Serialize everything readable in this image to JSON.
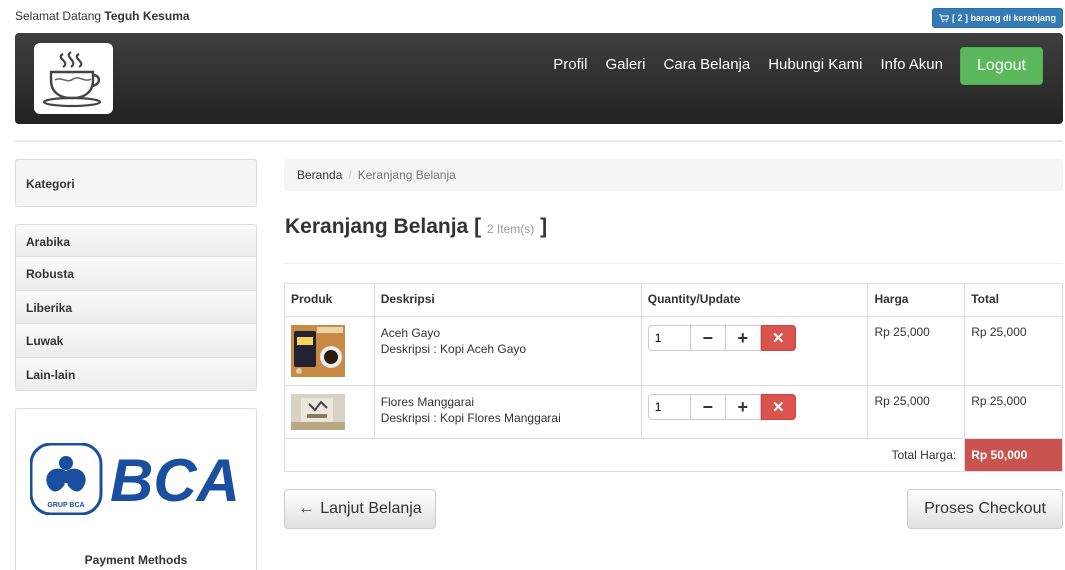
{
  "header": {
    "welcome_prefix": "Selamat Datang",
    "user_name": "Teguh Kesuma",
    "cart_badge": "[ 2 ] barang di keranjang"
  },
  "nav": {
    "items": [
      "Profil",
      "Galeri",
      "Cara Belanja",
      "Hubungi Kami",
      "Info Akun"
    ],
    "logout": "Logout"
  },
  "sidebar": {
    "heading": "Kategori",
    "categories": [
      "Arabika",
      "Robusta",
      "Liberika",
      "Luwak",
      "Lain-lain"
    ],
    "payment_label": "Payment Methods",
    "bank_logo_text": "BCA",
    "bank_logo_sub": "GRUP BCA"
  },
  "breadcrumb": {
    "home": "Beranda",
    "current": "Keranjang Belanja"
  },
  "page": {
    "title": "Keranjang Belanja",
    "bracket_open": "[",
    "item_count": "2 Item(s)",
    "bracket_close": "]"
  },
  "table": {
    "headers": [
      "Produk",
      "Deskripsi",
      "Quantity/Update",
      "Harga",
      "Total"
    ],
    "rows": [
      {
        "name": "Aceh Gayo",
        "desc": "Deskripsi : Kopi Aceh Gayo",
        "qty": "1",
        "price": "Rp 25,000",
        "total": "Rp 25,000"
      },
      {
        "name": "Flores Manggarai",
        "desc": "Deskripsi : Kopi Flores Manggarai",
        "qty": "1",
        "price": "Rp 25,000",
        "total": "Rp 25,000"
      }
    ],
    "total_label": "Total Harga:",
    "total_value": "Rp 50,000"
  },
  "actions": {
    "continue": "Lanjut Belanja",
    "checkout": "Proses Checkout"
  },
  "colors": {
    "primary": "#337ab7",
    "success": "#5cb85c",
    "danger": "#d9534f",
    "navbar": "#2d2d2d"
  }
}
